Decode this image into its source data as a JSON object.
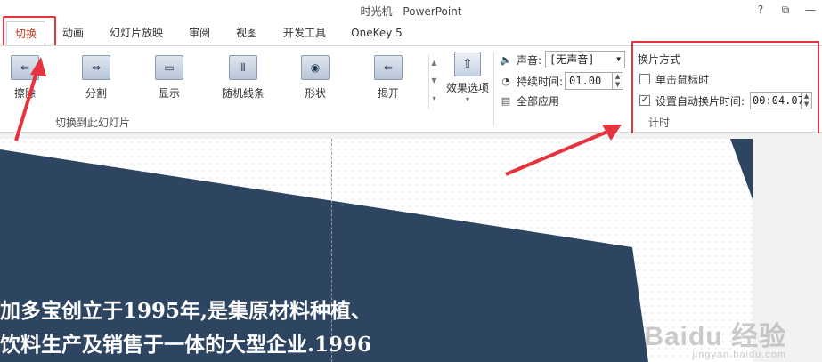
{
  "window": {
    "title": "时光机 - PowerPoint",
    "help_label": "?",
    "restore_label": "⧉",
    "minimize_label": "—"
  },
  "tabs": [
    {
      "label": "切换",
      "active": true
    },
    {
      "label": "动画"
    },
    {
      "label": "幻灯片放映"
    },
    {
      "label": "审阅"
    },
    {
      "label": "视图"
    },
    {
      "label": "开发工具"
    },
    {
      "label": "OneKey 5"
    }
  ],
  "ribbon": {
    "transitions": [
      {
        "label": "擦除",
        "icon": "wipe-icon",
        "glyph": "⇐"
      },
      {
        "label": "分割",
        "icon": "split-icon",
        "glyph": "⇔"
      },
      {
        "label": "显示",
        "icon": "reveal-icon",
        "glyph": "▭"
      },
      {
        "label": "随机线条",
        "icon": "random-bars-icon",
        "glyph": "⦀"
      },
      {
        "label": "形状",
        "icon": "shape-icon",
        "glyph": "◉"
      },
      {
        "label": "揭开",
        "icon": "uncover-icon",
        "glyph": "⇐"
      }
    ],
    "group_label": "切换到此幻灯片",
    "effect_options_label": "效果选项",
    "sound_label": "声音:",
    "sound_value": "[无声音]",
    "duration_label": "持续时间:",
    "duration_value": "01.00",
    "apply_all_label": "全部应用",
    "advance_header": "换片方式",
    "on_click_label": "单击鼠标时",
    "on_click_checked": false,
    "auto_label": "设置自动换片时间:",
    "auto_checked": true,
    "auto_value": "00:04.07",
    "timing_group_label": "计时"
  },
  "slide": {
    "line1": "加多宝创立于1995年,是集原材料种植、",
    "line2": "饮料生产及销售于一体的大型企业.1996",
    "bg_color": "#2e4562"
  },
  "watermark": {
    "main": "Baidu 经验",
    "sub": "jingyan.baidu.com"
  },
  "colors": {
    "active_tab": "#c23a1a",
    "highlight": "#e5343d",
    "slide_navy": "#2e4562"
  }
}
